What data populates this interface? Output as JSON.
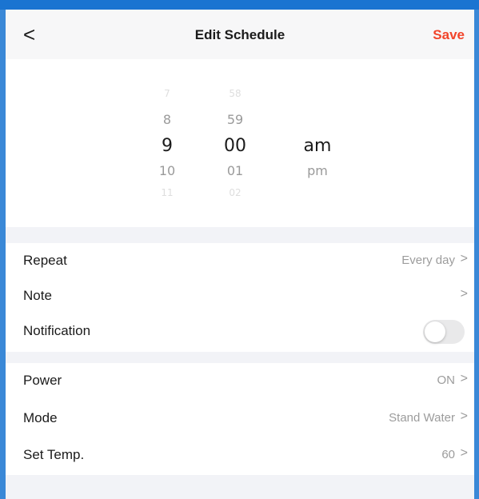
{
  "header": {
    "title": "Edit Schedule",
    "save_label": "Save",
    "back_glyph": "<"
  },
  "picker": {
    "hours": [
      "7",
      "8",
      "9",
      "10",
      "11"
    ],
    "minutes": [
      "58",
      "59",
      "00",
      "01",
      "02"
    ],
    "ampm": [
      "am",
      "pm"
    ],
    "selected": {
      "hour": "9",
      "minute": "00",
      "ampm": "am"
    }
  },
  "settings": {
    "repeat": {
      "label": "Repeat",
      "value": "Every day"
    },
    "note": {
      "label": "Note",
      "value": ""
    },
    "notification": {
      "label": "Notification",
      "enabled": false
    }
  },
  "device": {
    "power": {
      "label": "Power",
      "value": "ON"
    },
    "mode": {
      "label": "Mode",
      "value": "Stand Water"
    },
    "temp": {
      "label": "Set Temp.",
      "value": "60"
    }
  },
  "chevron": ">",
  "colors": {
    "accent": "#f2442a",
    "frame": "#1a74d1",
    "toggle_off": "#e9e9ea"
  }
}
